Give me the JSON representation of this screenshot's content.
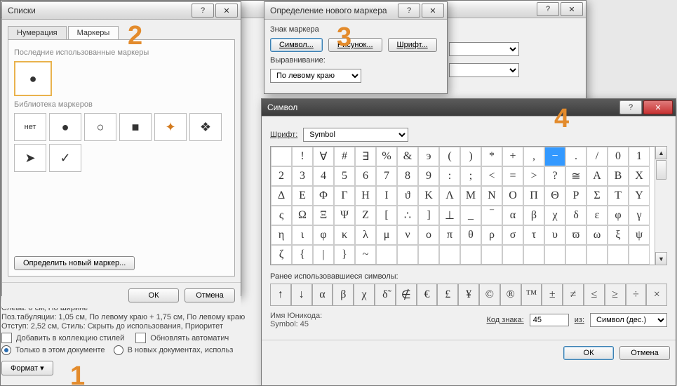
{
  "markers": {
    "m1": "1",
    "m2": "2",
    "m3": "3",
    "m4": "4"
  },
  "d1": {
    "title": "Списки",
    "tab_num": "Нумерация",
    "tab_bul": "Маркеры",
    "recent_title": "Последние использованные маркеры",
    "lib_title": "Библиотека маркеров",
    "none_label": "нет",
    "define_btn": "Определить новый маркер...",
    "ok": "ОК",
    "cancel": "Отмена"
  },
  "d2": {
    "title": "Определение нового маркера",
    "group": "Знак маркера",
    "symbol_btn": "Символ...",
    "picture_btn": "Рисунок...",
    "font_btn": "Шрифт...",
    "align_label": "Выравнивание:",
    "align_value": "По левому краю"
  },
  "d3": {
    "title": "Символ",
    "font_label": "Шрифт:",
    "font_value": "Symbol",
    "recent_label": "Ранее использовавшиеся символы:",
    "unicode_label": "Имя Юникода:",
    "unicode_value": "Symbol: 45",
    "code_label": "Код знака:",
    "code_value": "45",
    "from_label": "из:",
    "from_value": "Символ (дес.)",
    "ok": "ОК",
    "cancel": "Отмена",
    "rows": [
      [
        "",
        "!",
        "∀",
        "#",
        "∃",
        "%",
        "&",
        "э",
        "(",
        ")",
        "*",
        "+",
        ",",
        "−",
        ".",
        "/",
        "0",
        "1"
      ],
      [
        "2",
        "3",
        "4",
        "5",
        "6",
        "7",
        "8",
        "9",
        ":",
        ";",
        "<",
        "=",
        ">",
        "?",
        "≅",
        "A",
        "B",
        "X"
      ],
      [
        "Δ",
        "E",
        "Φ",
        "Γ",
        "H",
        "I",
        "ϑ",
        "K",
        "Λ",
        "M",
        "N",
        "O",
        "Π",
        "Θ",
        "P",
        "Σ",
        "T",
        "Y"
      ],
      [
        "ς",
        "Ω",
        "Ξ",
        "Ψ",
        "Z",
        "[",
        "∴",
        "]",
        "⊥",
        "_",
        "‾",
        "α",
        "β",
        "χ",
        "δ",
        "ε",
        "φ",
        "γ"
      ],
      [
        "η",
        "ι",
        "φ",
        "κ",
        "λ",
        "μ",
        "ν",
        "o",
        "π",
        "θ",
        "ρ",
        "σ",
        "τ",
        "υ",
        "ϖ",
        "ω",
        "ξ",
        "ψ"
      ],
      [
        "ζ",
        "{",
        "|",
        "}",
        "~",
        "",
        "",
        "",
        "",
        "",
        "",
        "",
        "",
        "",
        "",
        "",
        "",
        ""
      ]
    ],
    "selected": {
      "row": 0,
      "col": 13
    },
    "recent": [
      "↑",
      "↓",
      "α",
      "β",
      "χ",
      "δ̃",
      "∉",
      "€",
      "£",
      "¥",
      "©",
      "®",
      "™",
      "±",
      "≠",
      "≤",
      "≥",
      "÷",
      "×"
    ]
  },
  "bg": {
    "line1": "Слева: 0 см, По ширине",
    "line2": "Поз.табуляции: 1,05 см, По левому краю + 1,75 см, По левому краю",
    "line3": "Отступ: 2,52 см, Стиль: Скрыть до использования, Приоритет",
    "add_styles": "Добавить в коллекцию стилей",
    "auto_update": "Обновлять автоматич",
    "only_doc": "Только в этом документе",
    "new_docs": "В новых документах, использ",
    "format_btn": "Формат ▾"
  }
}
